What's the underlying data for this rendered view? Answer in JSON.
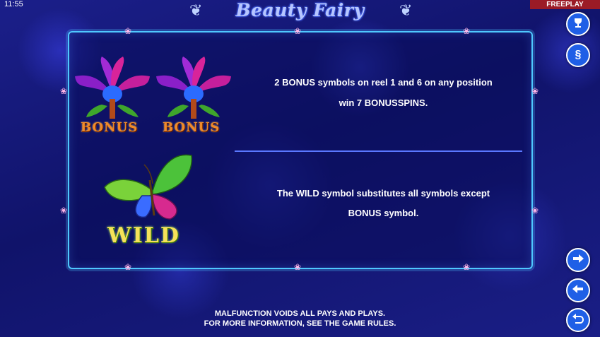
{
  "status_bar": {
    "time": "11:55",
    "mode_badge": "FREEPLAY"
  },
  "header": {
    "title": "Beauty Fairy"
  },
  "rules": [
    {
      "symbol_label": "BONUS",
      "lines": [
        "2 BONUS symbols on reel 1 and 6 on any position",
        "win 7 BONUSSPINS."
      ]
    },
    {
      "symbol_label": "WILD",
      "lines": [
        "The WILD symbol substitutes all symbols except",
        "BONUS symbol."
      ]
    }
  ],
  "side_buttons": {
    "paytable": "trophy-icon",
    "rules": "section-icon",
    "next": "arrow-right-icon",
    "prev": "arrow-left-icon",
    "back": "return-icon"
  },
  "footer": {
    "line1": "MALFUNCTION VOIDS ALL PAYS AND PLAYS.",
    "line2": "FOR MORE INFORMATION, SEE THE GAME RULES."
  },
  "colors": {
    "freeplay_badge": "#9b1b26",
    "panel_border": "#4fc8ff",
    "button": "#1f5fe6",
    "divider": "#5a78ff"
  }
}
